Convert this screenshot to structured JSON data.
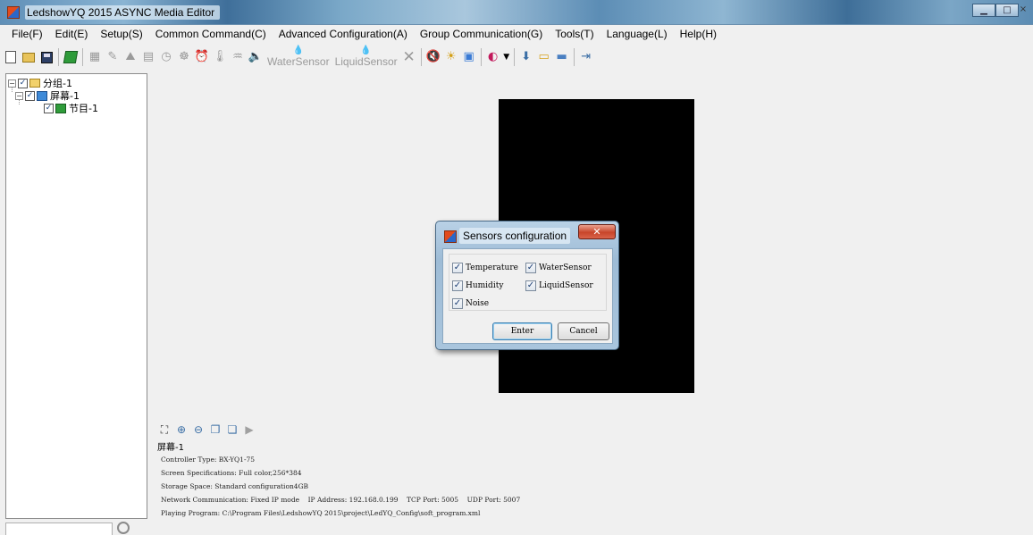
{
  "window": {
    "title": "LedshowYQ 2015 ASYNC Media Editor",
    "controls": [
      "minimize",
      "maximize",
      "close"
    ]
  },
  "menubar": {
    "items": [
      "File(F)",
      "Edit(E)",
      "Setup(S)",
      "Common Command(C)",
      "Advanced Configuration(A)",
      "Group Communication(G)",
      "Tools(T)",
      "Language(L)",
      "Help(H)"
    ]
  },
  "toolbar": {
    "water_sensor_label": "WaterSensor",
    "liquid_sensor_label": "LiquidSensor"
  },
  "tree": {
    "group": "分组-1",
    "screen": "屏幕-1",
    "program": "节目-1"
  },
  "dialog": {
    "title": "Sensors configuration",
    "options": [
      {
        "label": "Temperature",
        "checked": true
      },
      {
        "label": "WaterSensor",
        "checked": true
      },
      {
        "label": "Humidity",
        "checked": true
      },
      {
        "label": "LiquidSensor",
        "checked": true
      },
      {
        "label": "Noise",
        "checked": true
      }
    ],
    "enter_label": "Enter",
    "cancel_label": "Cancel"
  },
  "info": {
    "title": "屏幕-1",
    "lines": [
      "Controller Type: BX-YQ1-75",
      "Screen Specifications: Full color,256*384",
      "Storage Space: Standard configuration4GB",
      "Network Communication: Fixed IP mode    IP Address: 192.168.0.199    TCP Port: 5005    UDP Port: 5007",
      "Playing Program: C:\\Program Files\\LedshowYQ 2015\\project\\LedYQ_Config\\soft_program.xml"
    ]
  },
  "colors": {
    "led_screen": "#000000",
    "dialog_frame": "#a9c5dd",
    "close_button": "#c8452a"
  }
}
